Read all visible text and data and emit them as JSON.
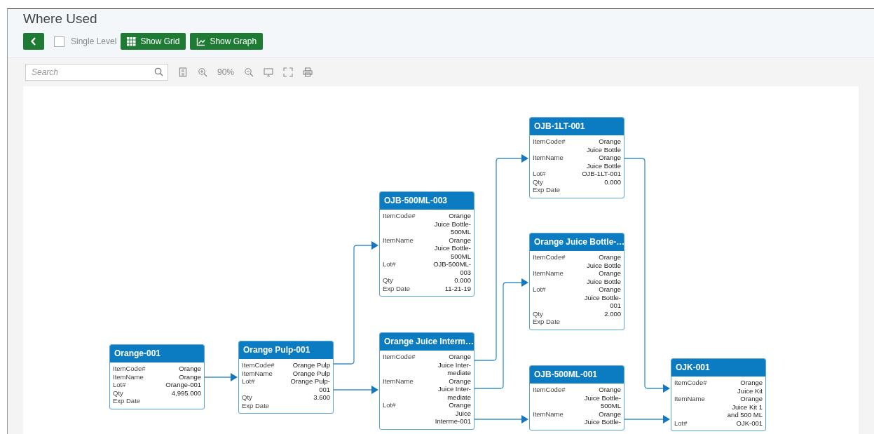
{
  "page": {
    "title": "Where Used"
  },
  "toolbar": {
    "single_level": {
      "label": "Single Level",
      "checked": false
    },
    "buttons": [
      {
        "kind": "grid",
        "label": "Show Grid"
      },
      {
        "kind": "graph",
        "label": "Show Graph"
      }
    ]
  },
  "graph_toolbar": {
    "search": {
      "placeholder": "Search"
    },
    "zoom": "90%"
  },
  "nodes": [
    {
      "title": "Orange-001",
      "rows": [
        {
          "label": "ItemCode#",
          "value": [
            "Orange"
          ]
        },
        {
          "label": "ItemName",
          "value": [
            "Orange"
          ]
        },
        {
          "label": "Lot#",
          "value": [
            "Orange-001"
          ]
        },
        {
          "label": "Qty",
          "value": [
            "4,995.000"
          ]
        },
        {
          "label": "Exp Date",
          "value": []
        }
      ]
    },
    {
      "title": "Orange Pulp-001",
      "rows": [
        {
          "label": "ItemCode#",
          "value": [
            "Orange Pulp"
          ]
        },
        {
          "label": "ItemName",
          "value": [
            "Orange Pulp"
          ]
        },
        {
          "label": "Lot#",
          "value": [
            "Orange Pulp-",
            "001"
          ]
        },
        {
          "label": "Qty",
          "value": [
            "3.600"
          ]
        },
        {
          "label": "Exp Date",
          "value": []
        }
      ]
    },
    {
      "title": "OJB-500ML-003",
      "rows": [
        {
          "label": "ItemCode#",
          "value": [
            "Orange",
            "Juice Bottle-",
            "500ML"
          ]
        },
        {
          "label": "ItemName",
          "value": [
            "Orange",
            "Juice Bottle-",
            "500ML"
          ]
        },
        {
          "label": "Lot#",
          "value": [
            "OJB-500ML-",
            "003"
          ]
        },
        {
          "label": "Qty",
          "value": [
            "0.000"
          ]
        },
        {
          "label": "Exp Date",
          "value": [
            "11-21-19"
          ]
        }
      ]
    },
    {
      "title": "Orange Juice Interm…",
      "rows": [
        {
          "label": "ItemCode#",
          "value": [
            "Orange",
            "Juice Inter-",
            "mediate"
          ]
        },
        {
          "label": "ItemName",
          "value": [
            "Orange",
            "Juice Inter-",
            "mediate"
          ]
        },
        {
          "label": "Lot#",
          "value": [
            "Orange",
            "Juice",
            "Interme-001"
          ]
        }
      ]
    },
    {
      "title": "OJB-1LT-001",
      "rows": [
        {
          "label": "ItemCode#",
          "value": [
            "Orange",
            "Juice Bottle"
          ]
        },
        {
          "label": "ItemName",
          "value": [
            "Orange",
            "Juice Bottle"
          ]
        },
        {
          "label": "Lot#",
          "value": [
            "OJB-1LT-001"
          ]
        },
        {
          "label": "Qty",
          "value": [
            "0.000"
          ]
        },
        {
          "label": "Exp Date",
          "value": []
        }
      ]
    },
    {
      "title": "Orange Juice Bottle-…",
      "rows": [
        {
          "label": "ItemCode#",
          "value": [
            "Orange",
            "Juice Bottle"
          ]
        },
        {
          "label": "ItemName",
          "value": [
            "Orange",
            "Juice Bottle"
          ]
        },
        {
          "label": "Lot#",
          "value": [
            "Orange",
            "Juice Bottle-",
            "001"
          ]
        },
        {
          "label": "Qty",
          "value": [
            "2.000"
          ]
        },
        {
          "label": "Exp Date",
          "value": []
        }
      ]
    },
    {
      "title": "OJB-500ML-001",
      "rows": [
        {
          "label": "ItemCode#",
          "value": [
            "Orange",
            "Juice Bottle-",
            "500ML"
          ]
        },
        {
          "label": "ItemName",
          "value": [
            "Orange",
            "Juice Bottle-"
          ]
        }
      ]
    },
    {
      "title": "OJK-001",
      "rows": [
        {
          "label": "ItemCode#",
          "value": [
            "Orange",
            "Juice Kit"
          ]
        },
        {
          "label": "ItemName",
          "value": [
            "Orange",
            "Juice Kit 1",
            "and 500 ML"
          ]
        },
        {
          "label": "Lot#",
          "value": [
            "OJK-001"
          ]
        }
      ]
    }
  ]
}
